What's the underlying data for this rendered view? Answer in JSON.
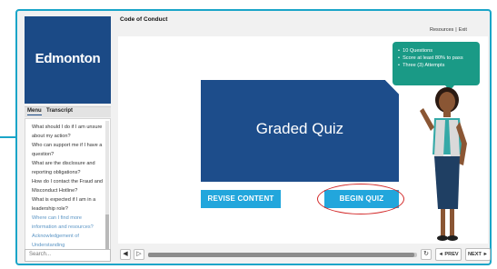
{
  "course_title": "Code of Conduct",
  "header_links": {
    "resources": "Resources",
    "separator": "|",
    "exit": "Exit"
  },
  "logo_text": "Edmonton",
  "menu_tabs": {
    "menu": "Menu",
    "transcript": "Transcript"
  },
  "menu_items": [
    {
      "label": "What should I do if I am unsure",
      "visited": false
    },
    {
      "label": "about my action?",
      "visited": false
    },
    {
      "label": "Who can support me if I have a",
      "visited": false
    },
    {
      "label": "question?",
      "visited": false
    },
    {
      "label": "What are the disclosure and",
      "visited": false
    },
    {
      "label": "reporting obligations?",
      "visited": false
    },
    {
      "label": "How do I contact the Fraud and",
      "visited": false
    },
    {
      "label": "Misconduct Hotline?",
      "visited": false
    },
    {
      "label": "What is expected if I am in a",
      "visited": false
    },
    {
      "label": "leadership role?",
      "visited": false
    },
    {
      "label": "Where can I find more",
      "visited": true
    },
    {
      "label": "information and resources?",
      "visited": true
    },
    {
      "label": "Acknowledgement of",
      "visited": true
    },
    {
      "label": "Understanding",
      "visited": true
    }
  ],
  "search": {
    "placeholder": "Search..."
  },
  "slide": {
    "quiz_title": "Graded Quiz",
    "revise_label": "REVISE CONTENT",
    "begin_label": "BEGIN QUIZ",
    "bubble": [
      "10 Questions",
      "Score at least 80% to pass",
      "Three (3) Attempts"
    ]
  },
  "player": {
    "prev_label": "◄ PREV",
    "next_label": "NEXT ►",
    "progress": 0.99,
    "volume_icon": "speaker-icon",
    "play_icon": "play-icon",
    "replay_icon": "replay-icon"
  },
  "colors": {
    "accent": "#1aa5c8",
    "brand_blue": "#1b4a86",
    "button_blue": "#22a6dc",
    "bubble_teal": "#1a9a86",
    "highlight_red": "#d32a2a"
  }
}
